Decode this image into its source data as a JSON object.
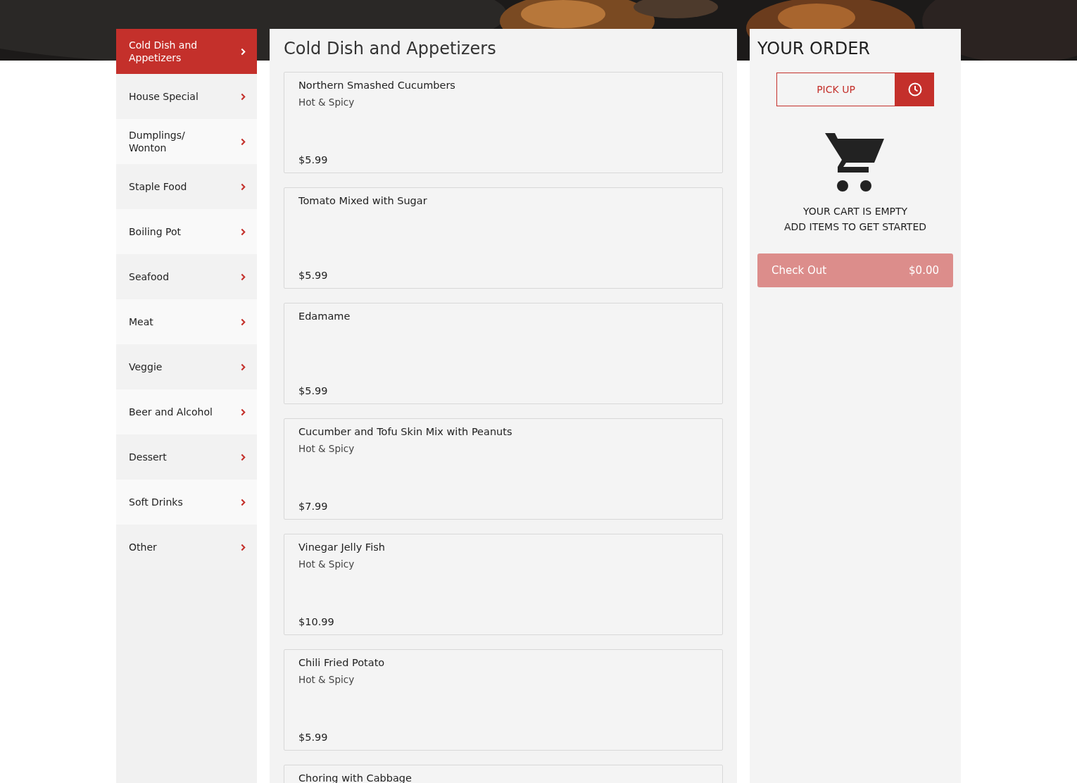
{
  "categories": [
    {
      "label": "Cold Dish and Appetizers",
      "selected": true
    },
    {
      "label": "House Special",
      "selected": false
    },
    {
      "label": "Dumplings/ Wonton",
      "selected": false
    },
    {
      "label": "Staple Food",
      "selected": false
    },
    {
      "label": "Boiling Pot",
      "selected": false
    },
    {
      "label": "Seafood",
      "selected": false
    },
    {
      "label": "Meat",
      "selected": false
    },
    {
      "label": "Veggie",
      "selected": false
    },
    {
      "label": "Beer and Alcohol",
      "selected": false
    },
    {
      "label": "Dessert",
      "selected": false
    },
    {
      "label": "Soft Drinks",
      "selected": false
    },
    {
      "label": "Other",
      "selected": false
    }
  ],
  "menu": {
    "title": "Cold Dish and Appetizers",
    "items": [
      {
        "name": "Northern Smashed Cucumbers",
        "description": "Hot & Spicy",
        "price": "$5.99"
      },
      {
        "name": "Tomato Mixed with Sugar",
        "price": "$5.99"
      },
      {
        "name": "Edamame",
        "price": "$5.99"
      },
      {
        "name": "Cucumber and Tofu Skin Mix with Peanuts",
        "description": "Hot & Spicy",
        "price": "$7.99"
      },
      {
        "name": "Vinegar Jelly Fish",
        "description": "Hot & Spicy",
        "price": "$10.99"
      },
      {
        "name": "Chili Fried Potato",
        "description": "Hot & Spicy",
        "price": "$5.99"
      },
      {
        "name": "Choring with Cabbage"
      }
    ]
  },
  "order": {
    "title": "YOUR ORDER",
    "mode_button": "PICK UP",
    "empty_line_1": "YOUR CART IS EMPTY",
    "empty_line_2": "ADD ITEMS TO GET STARTED",
    "checkout_label": "Check Out",
    "checkout_total": "$0.00"
  }
}
